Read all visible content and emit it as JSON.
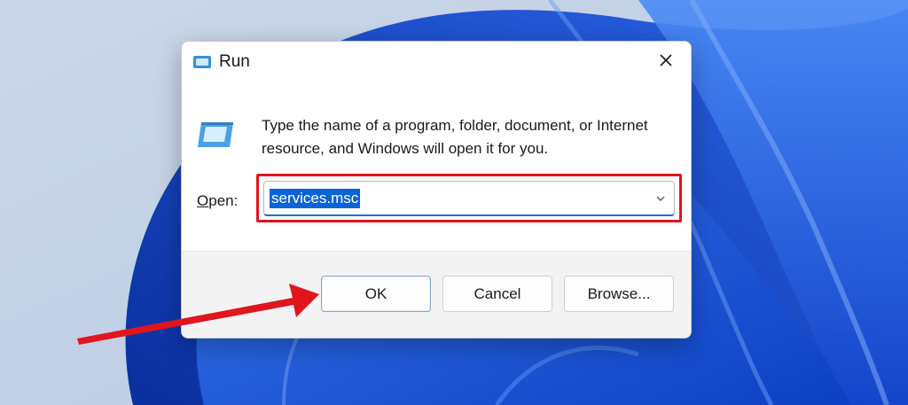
{
  "dialog": {
    "title": "Run",
    "description": "Type the name of a program, folder, document, or Internet resource, and Windows will open it for you.",
    "open_label_prefix": "",
    "open_label_accel": "O",
    "open_label_rest": "pen:",
    "open_value": "services.msc"
  },
  "buttons": {
    "ok": "OK",
    "cancel": "Cancel",
    "browse": "Browse..."
  },
  "colors": {
    "highlight": "#e0151d",
    "arrow": "#e0151d",
    "selection": "#0a64d6",
    "wallpaper_blue": "#1f5fe0"
  },
  "icons": {
    "title": "run-icon",
    "body": "run-icon",
    "close": "close-icon",
    "dropdown": "chevron-down-icon"
  }
}
